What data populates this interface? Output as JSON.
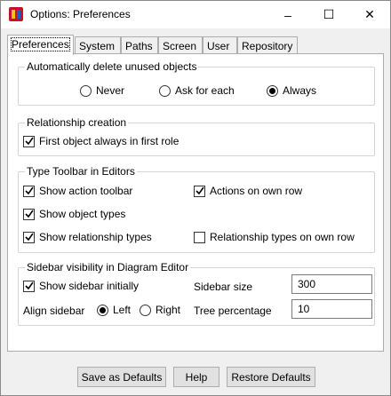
{
  "window": {
    "title": "Options: Preferences",
    "controls": {
      "minimize": "–",
      "maximize": "☐",
      "close": "✕"
    }
  },
  "tabs": [
    {
      "label": "Preferences",
      "active": true
    },
    {
      "label": "System"
    },
    {
      "label": "Paths"
    },
    {
      "label": "Screen"
    },
    {
      "label": "User"
    },
    {
      "label": "Repository"
    }
  ],
  "delete_group": {
    "label": "Automatically delete unused objects",
    "options": [
      {
        "label": "Never",
        "selected": false
      },
      {
        "label": "Ask for each",
        "selected": false
      },
      {
        "label": "Always",
        "selected": true
      }
    ]
  },
  "relationship_group": {
    "label": "Relationship creation",
    "first_object": {
      "label": "First object always in first role",
      "checked": true
    }
  },
  "toolbar_group": {
    "label": "Type Toolbar in Editors",
    "show_action_toolbar": {
      "label": "Show action toolbar",
      "checked": true
    },
    "actions_own_row": {
      "label": "Actions on own row",
      "checked": true
    },
    "show_object_types": {
      "label": "Show object types",
      "checked": true
    },
    "show_relationship_types": {
      "label": "Show relationship types",
      "checked": true
    },
    "relationship_types_own_row": {
      "label": "Relationship types on own row",
      "checked": false
    }
  },
  "sidebar_group": {
    "label": "Sidebar visibility in Diagram Editor",
    "show_sidebar": {
      "label": "Show sidebar initially",
      "checked": true
    },
    "align_label": "Align sidebar",
    "align_left": {
      "label": "Left",
      "selected": true
    },
    "align_right": {
      "label": "Right",
      "selected": false
    },
    "sidebar_size_label": "Sidebar size",
    "sidebar_size_value": "300",
    "tree_percentage_label": "Tree percentage",
    "tree_percentage_value": "10"
  },
  "buttons": {
    "save_defaults": "Save as Defaults",
    "help": "Help",
    "restore_defaults": "Restore Defaults"
  },
  "colors": {
    "window_bg": "#f0f0f0",
    "panel_bg": "#ffffff",
    "button_bg": "#e1e1e1",
    "border": "#adadad"
  }
}
